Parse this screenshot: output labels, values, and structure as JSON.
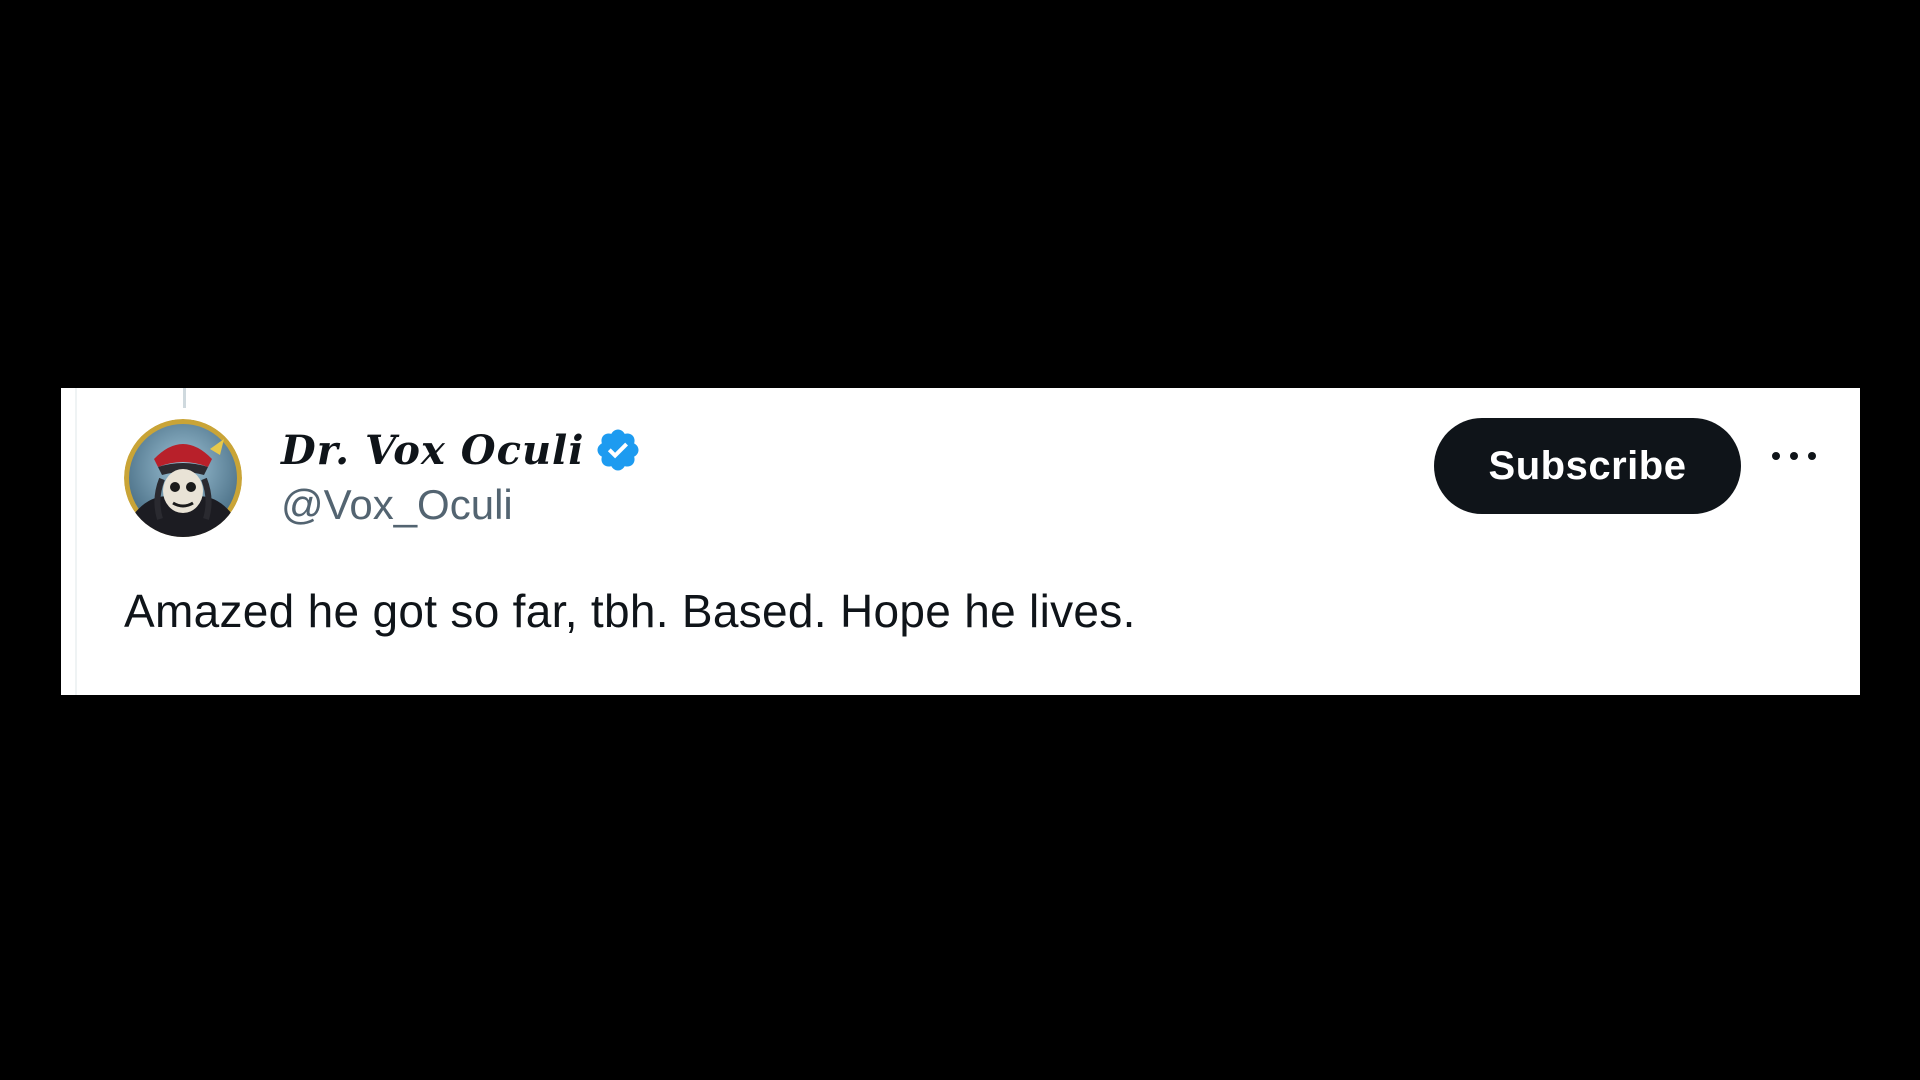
{
  "tweet": {
    "author": {
      "display_name": "Dr. Vox Oculi",
      "handle": "@Vox_Oculi",
      "verified": true,
      "avatar_icon": "pirate-skull-avatar"
    },
    "subscribe_label": "Subscribe",
    "more_icon": "more-horizontal-icon",
    "text": "Amazed he got so far, tbh. Based. Hope he lives."
  },
  "colors": {
    "background": "#000000",
    "card": "#ffffff",
    "text_primary": "#0f1419",
    "text_secondary": "#536471",
    "verified_badge": "#1d9bf0",
    "subscribe_bg": "#0f1419"
  }
}
